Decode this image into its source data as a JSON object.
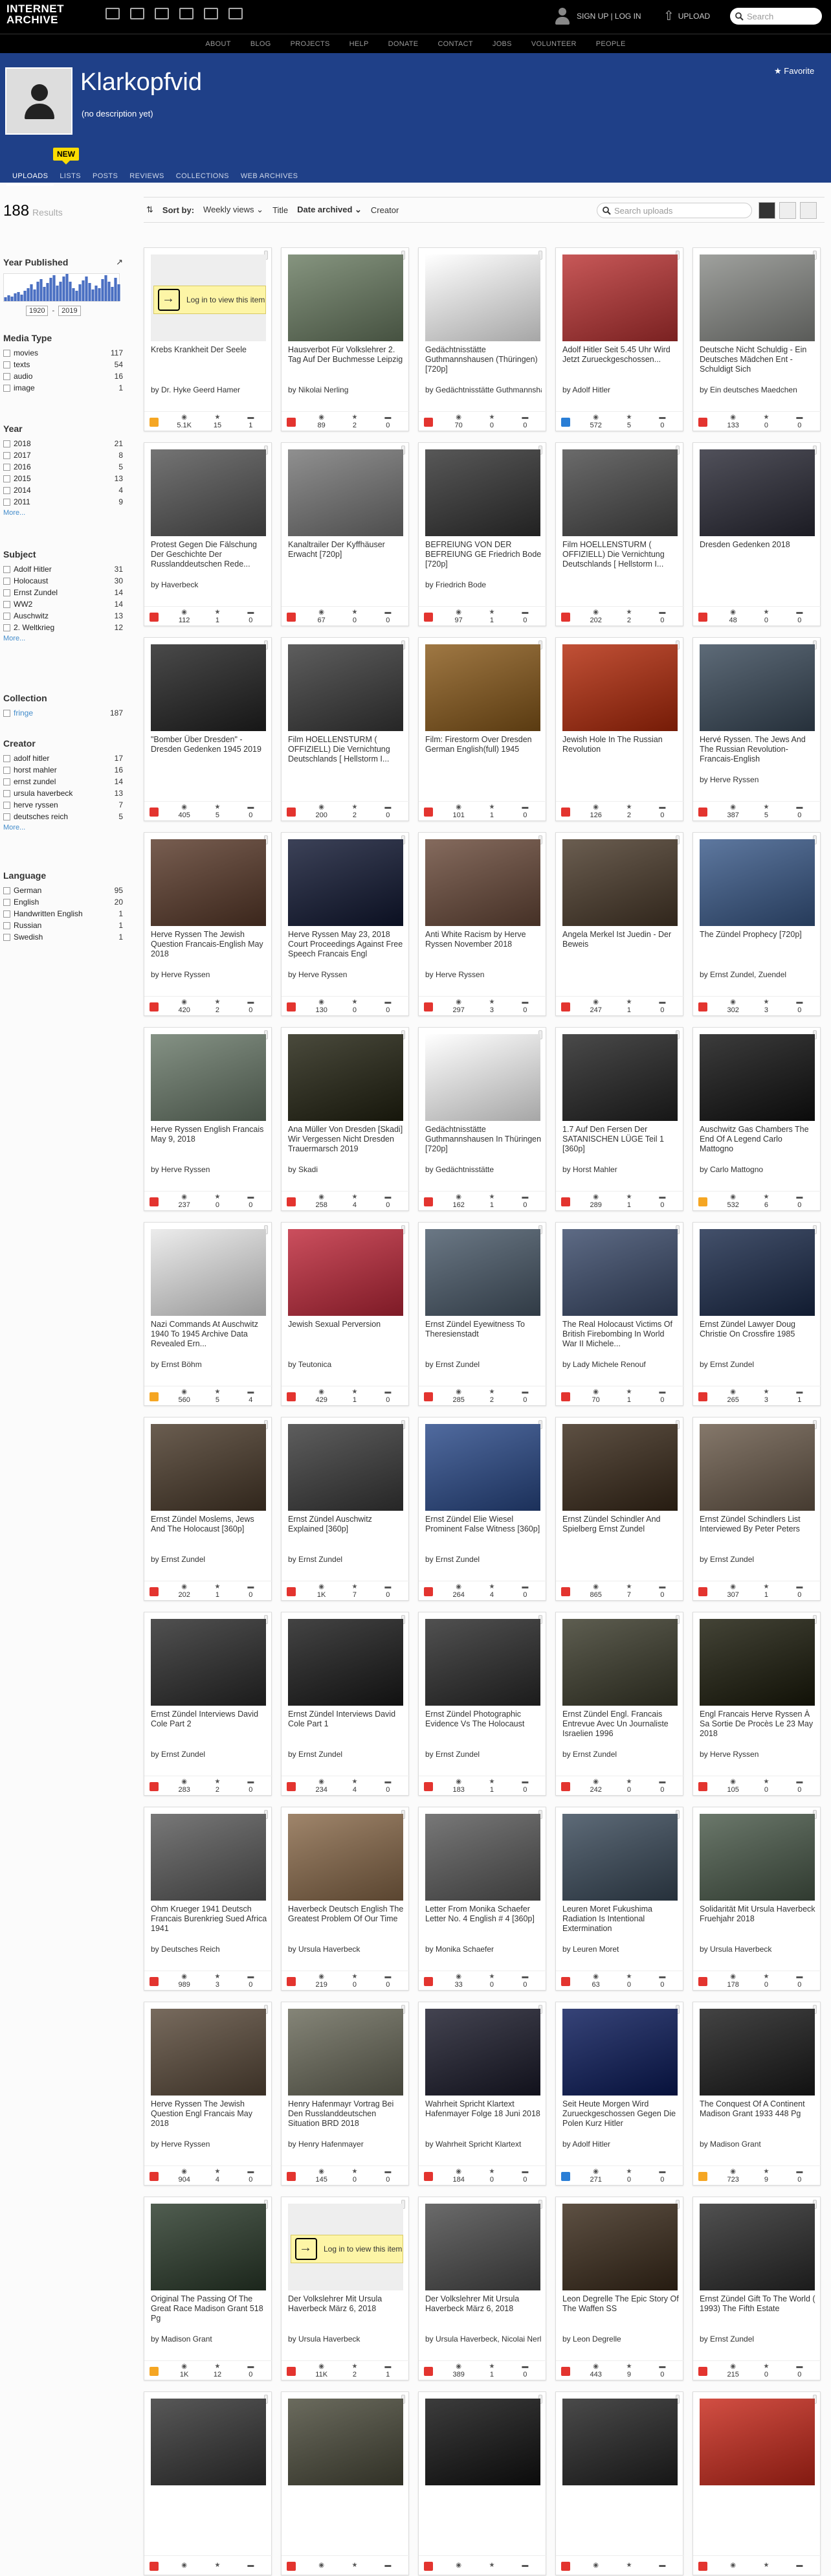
{
  "header": {
    "logo": "INTERNET\nARCHIVE",
    "signup": "SIGN UP | LOG IN",
    "upload": "UPLOAD",
    "search_placeholder": "Search",
    "nav": [
      "ABOUT",
      "BLOG",
      "PROJECTS",
      "HELP",
      "DONATE",
      "CONTACT",
      "JOBS",
      "VOLUNTEER",
      "PEOPLE"
    ]
  },
  "profile": {
    "title": "Klarkopfvid",
    "description": "(no description yet)",
    "favorite": "Favorite",
    "new_badge": "NEW",
    "tabs": [
      "UPLOADS",
      "LISTS",
      "POSTS",
      "REVIEWS",
      "COLLECTIONS",
      "WEB ARCHIVES"
    ]
  },
  "sidebar": {
    "results_count": "188",
    "results_label": "Results",
    "year_published": "Year Published",
    "year_from": "1920",
    "year_to": "2019",
    "more": "More...",
    "facets": [
      {
        "title": "Media Type",
        "items": [
          [
            "movies",
            "117"
          ],
          [
            "texts",
            "54"
          ],
          [
            "audio",
            "16"
          ],
          [
            "image",
            "1"
          ]
        ]
      },
      {
        "title": "Year",
        "items": [
          [
            "2018",
            "21"
          ],
          [
            "2017",
            "8"
          ],
          [
            "2016",
            "5"
          ],
          [
            "2015",
            "13"
          ],
          [
            "2014",
            "4"
          ],
          [
            "2011",
            "9"
          ]
        ],
        "more": true
      },
      {
        "title": "Subject",
        "items": [
          [
            "Adolf Hitler",
            "31"
          ],
          [
            "Holocaust",
            "30"
          ],
          [
            "Ernst Zundel",
            "14"
          ],
          [
            "WW2",
            "14"
          ],
          [
            "Auschwitz",
            "13"
          ],
          [
            "2. Weltkrieg",
            "12"
          ]
        ],
        "more": true
      },
      {
        "title": "Collection",
        "items": [
          [
            "fringe",
            "187"
          ]
        ]
      },
      {
        "title": "Creator",
        "items": [
          [
            "adolf hitler",
            "17"
          ],
          [
            "horst mahler",
            "16"
          ],
          [
            "ernst zundel",
            "14"
          ],
          [
            "ursula haverbeck",
            "13"
          ],
          [
            "herve ryssen",
            "7"
          ],
          [
            "deutsches reich",
            "5"
          ]
        ],
        "more": true
      },
      {
        "title": "Language",
        "items": [
          [
            "German",
            "95"
          ],
          [
            "English",
            "20"
          ],
          [
            "Handwritten English",
            "1"
          ],
          [
            "Russian",
            "1"
          ],
          [
            "Swedish",
            "1"
          ]
        ]
      }
    ]
  },
  "sortbar": {
    "label": "Sort by:",
    "options": [
      "Weekly views",
      "Title",
      "Date archived",
      "Creator"
    ],
    "search_placeholder": "Search uploads"
  },
  "items": [
    {
      "t": "Krebs Krankheit Der Seele",
      "by": "by Dr. Hyke Geerd Hamer",
      "views": "5.1K",
      "fav": "15",
      "rev": "1",
      "type": "text",
      "login": "Log in to view this item",
      "c": "#f3e8d4"
    },
    {
      "t": "Hausverbot Für Volkslehrer 2. Tag Auf Der Buchmesse Leipzig",
      "by": "by Nikolai Nerling",
      "views": "89",
      "fav": "2",
      "rev": "0",
      "type": "movie",
      "c": "#6b7d63"
    },
    {
      "t": "Gedächtnisstätte Guthmannshausen (Thüringen) [720p]",
      "by": "by Gedächtnisstätte Guthmannshausen",
      "views": "70",
      "fav": "0",
      "rev": "0",
      "type": "movie",
      "c": "#ffffff"
    },
    {
      "t": "Adolf Hitler Seit 5.45 Uhr Wird Jetzt Zurueckgeschossen...",
      "by": "by Adolf Hitler",
      "views": "572",
      "fav": "5",
      "rev": "0",
      "type": "audio",
      "c": "#b33"
    },
    {
      "t": "Deutsche Nicht Schuldig - Ein Deutsches Mädchen Ent - Schuldigt Sich",
      "by": "by Ein deutsches Maedchen",
      "views": "133",
      "fav": "0",
      "rev": "0",
      "type": "movie",
      "c": "#8a8c88"
    },
    {
      "t": "Protest Gegen Die Fälschung Der Geschichte Der Russlanddeutschen Rede...",
      "by": "by Haverbeck",
      "views": "112",
      "fav": "1",
      "rev": "0",
      "type": "movie",
      "c": "#555"
    },
    {
      "t": "Kanaltrailer Der Kyffhäuser Erwacht [720p]",
      "by": "",
      "views": "67",
      "fav": "0",
      "rev": "0",
      "type": "movie",
      "c": "#777"
    },
    {
      "t": "BEFREIUNG VON DER BEFREIUNG GE Friedrich Bode [720p]",
      "by": "by Friedrich Bode",
      "views": "97",
      "fav": "1",
      "rev": "0",
      "type": "movie",
      "c": "#333"
    },
    {
      "t": "Film HOELLENSTURM ( OFFIZIELL) Die Vernichtung Deutschlands [ Hellstorm I...",
      "by": "",
      "views": "202",
      "fav": "2",
      "rev": "0",
      "type": "movie",
      "c": "#4a4a4a"
    },
    {
      "t": "Dresden Gedenken 2018",
      "by": "",
      "views": "48",
      "fav": "0",
      "rev": "0",
      "type": "movie",
      "c": "#2a2a36"
    },
    {
      "t": "\"Bomber Über Dresden\" - Dresden Gedenken 1945 2019",
      "by": "",
      "views": "405",
      "fav": "5",
      "rev": "0",
      "type": "movie",
      "c": "#222"
    },
    {
      "t": "Film HOELLENSTURM ( OFFIZIELL) Die Vernichtung Deutschlands [ Hellstorm I...",
      "by": "",
      "views": "200",
      "fav": "2",
      "rev": "0",
      "type": "movie",
      "c": "#3a3a3a"
    },
    {
      "t": "Film: Firestorm Over Dresden German English(full) 1945",
      "by": "",
      "views": "101",
      "fav": "1",
      "rev": "0",
      "type": "movie",
      "c": "#8a5a1a"
    },
    {
      "t": "Jewish Hole In The Russian Revolution",
      "by": "",
      "views": "126",
      "fav": "2",
      "rev": "0",
      "type": "movie",
      "c": "#b42a0a"
    },
    {
      "t": "Hervé Ryssen. The Jews And The Russian Revolution-Francais-English",
      "by": "by Herve Ryssen",
      "views": "387",
      "fav": "5",
      "rev": "0",
      "type": "movie",
      "c": "#3a4a5a"
    },
    {
      "t": "Herve Ryssen The Jewish Question Francais-English May 2018",
      "by": "by Herve Ryssen",
      "views": "420",
      "fav": "2",
      "rev": "0",
      "type": "movie",
      "c": "#5a3a2a"
    },
    {
      "t": "Herve Ryssen May 23, 2018 Court Proceedings Against Free Speech Francais Engl",
      "by": "by Herve Ryssen",
      "views": "130",
      "fav": "0",
      "rev": "0",
      "type": "movie",
      "c": "#111833"
    },
    {
      "t": "Anti White Racism by Herve Ryssen November 2018",
      "by": "by Herve Ryssen",
      "views": "297",
      "fav": "3",
      "rev": "0",
      "type": "movie",
      "c": "#6a4a3a"
    },
    {
      "t": "Angela Merkel Ist Juedin - Der Beweis",
      "by": "",
      "views": "247",
      "fav": "1",
      "rev": "0",
      "type": "movie",
      "c": "#4a3a2a"
    },
    {
      "t": "The Zündel Prophecy [720p]",
      "by": "by Ernst Zundel, Zuendel",
      "views": "302",
      "fav": "3",
      "rev": "0",
      "type": "movie",
      "c": "#3a5a8a"
    },
    {
      "t": "Herve Ryssen English Francais May 9, 2018",
      "by": "by Herve Ryssen",
      "views": "237",
      "fav": "0",
      "rev": "0",
      "type": "movie",
      "c": "#6a7a6a"
    },
    {
      "t": "Ana Müller Von Dresden [Skadi] Wir Vergessen Nicht Dresden Trauermarsch 2019",
      "by": "by Skadi",
      "views": "258",
      "fav": "4",
      "rev": "0",
      "type": "movie",
      "c": "#222211"
    },
    {
      "t": "Gedächtnisstätte Guthmannshausen In Thüringen [720p]",
      "by": "by Gedächtnisstätte",
      "views": "162",
      "fav": "1",
      "rev": "0",
      "type": "movie",
      "c": "#ffffff"
    },
    {
      "t": "1.7 Auf Den Fersen Der SATANISCHEN LÜGE Teil 1 [360p]",
      "by": "by Horst Mahler",
      "views": "289",
      "fav": "1",
      "rev": "0",
      "type": "movie",
      "c": "#222"
    },
    {
      "t": "Auschwitz Gas Chambers The End Of A Legend Carlo Mattogno",
      "by": "by Carlo Mattogno",
      "views": "532",
      "fav": "6",
      "rev": "0",
      "type": "text",
      "c": "#111"
    },
    {
      "t": "Nazi Commands At Auschwitz 1940 To 1945 Archive Data Revealed Ern...",
      "by": "by Ernst Böhm",
      "views": "560",
      "fav": "5",
      "rev": "4",
      "type": "text",
      "c": "#e8e8e8"
    },
    {
      "t": "Jewish Sexual Perversion",
      "by": "by Teutonica",
      "views": "429",
      "fav": "1",
      "rev": "0",
      "type": "movie",
      "c": "#c0283a"
    },
    {
      "t": "Ernst Zündel Eyewitness To Theresienstadt",
      "by": "by Ernst Zundel",
      "views": "285",
      "fav": "2",
      "rev": "0",
      "type": "movie",
      "c": "#4a5a6a"
    },
    {
      "t": "The Real Holocaust Victims Of British Firebombing In World War II Michele...",
      "by": "by Lady Michele Renouf",
      "views": "70",
      "fav": "1",
      "rev": "0",
      "type": "movie",
      "c": "#3a4a6a"
    },
    {
      "t": "Ernst Zündel Lawyer Doug Christie On Crossfire 1985",
      "by": "by Ernst Zundel",
      "views": "265",
      "fav": "3",
      "rev": "1",
      "type": "movie",
      "c": "#1a2a4a"
    },
    {
      "t": "Ernst Zündel Moslems, Jews And The Holocaust [360p]",
      "by": "by Ernst Zundel",
      "views": "202",
      "fav": "1",
      "rev": "0",
      "type": "movie",
      "c": "#4a3a2a"
    },
    {
      "t": "Ernst Zündel Auschwitz Explained [360p]",
      "by": "by Ernst Zundel",
      "views": "1K",
      "fav": "7",
      "rev": "0",
      "type": "movie",
      "c": "#3a3a3a"
    },
    {
      "t": "Ernst Zündel Elie Wiesel Prominent False Witness [360p]",
      "by": "by Ernst Zundel",
      "views": "264",
      "fav": "4",
      "rev": "0",
      "type": "movie",
      "c": "#2a4a8a"
    },
    {
      "t": "Ernst Zündel Schindler And Spielberg Ernst Zundel",
      "by": "",
      "views": "865",
      "fav": "7",
      "rev": "0",
      "type": "movie",
      "c": "#3a2a1a"
    },
    {
      "t": "Ernst Zündel Schindlers List Interviewed By Peter Peters",
      "by": "by Ernst Zundel",
      "views": "307",
      "fav": "1",
      "rev": "0",
      "type": "movie",
      "c": "#6a5a4a"
    },
    {
      "t": "Ernst Zündel Interviews David Cole Part 2",
      "by": "by Ernst Zundel",
      "views": "283",
      "fav": "2",
      "rev": "0",
      "type": "movie",
      "c": "#2a2a2a"
    },
    {
      "t": "Ernst Zündel Interviews David Cole Part 1",
      "by": "by Ernst Zundel",
      "views": "234",
      "fav": "4",
      "rev": "0",
      "type": "movie",
      "c": "#1a1a1a"
    },
    {
      "t": "Ernst Zündel Photographic Evidence Vs The Holocaust",
      "by": "by Ernst Zundel",
      "views": "183",
      "fav": "1",
      "rev": "0",
      "type": "movie",
      "c": "#2a2a2a"
    },
    {
      "t": "Ernst Zündel Engl. Francais Entrevue Avec Un Journaliste Israelien 1996",
      "by": "by Ernst Zundel",
      "views": "242",
      "fav": "0",
      "rev": "0",
      "type": "movie",
      "c": "#3a3a2a"
    },
    {
      "t": "Engl Francais Herve Ryssen À Sa Sortie De Procès Le 23 May 2018",
      "by": "by Herve Ryssen",
      "views": "105",
      "fav": "0",
      "rev": "0",
      "type": "movie",
      "c": "#1a1a0a"
    },
    {
      "t": "Ohm Krueger 1941 Deutsch Francais Burenkrieg Sued Africa 1941",
      "by": "by Deutsches Reich",
      "views": "989",
      "fav": "3",
      "rev": "0",
      "type": "movie",
      "c": "#5a5a5a"
    },
    {
      "t": "Haverbeck Deutsch English The Greatest Problem Of Our Time",
      "by": "by Ursula Haverbeck",
      "views": "219",
      "fav": "0",
      "rev": "0",
      "type": "movie",
      "c": "#8a6a4a"
    },
    {
      "t": "Letter From Monika Schaefer Letter No. 4 English # 4 [360p]",
      "by": "by Monika Schaefer",
      "views": "33",
      "fav": "0",
      "rev": "0",
      "type": "movie",
      "c": "#5a5a5a"
    },
    {
      "t": "Leuren Moret Fukushima Radiation Is Intentional Extermination",
      "by": "by Leuren Moret",
      "views": "63",
      "fav": "0",
      "rev": "0",
      "type": "movie",
      "c": "#3a4a5a"
    },
    {
      "t": "Solidarität Mit Ursula Haverbeck Fruehjahr 2018",
      "by": "by Ursula Haverbeck",
      "views": "178",
      "fav": "0",
      "rev": "0",
      "type": "movie",
      "c": "#4a5a4a"
    },
    {
      "t": "Herve Ryssen The Jewish Question Engl Francais May 2018",
      "by": "by Herve Ryssen",
      "views": "904",
      "fav": "4",
      "rev": "0",
      "type": "movie",
      "c": "#5a4a3a"
    },
    {
      "t": "Henry Hafenmayr Vortrag Bei Den Russlanddeutschen Situation BRD 2018",
      "by": "by Henry Hafenmayer",
      "views": "145",
      "fav": "0",
      "rev": "0",
      "type": "movie",
      "c": "#6a6a5a"
    },
    {
      "t": "Wahrheit Spricht Klartext Hafenmayer Folge 18 Juni 2018",
      "by": "by Wahrheit Spricht Klartext",
      "views": "184",
      "fav": "0",
      "rev": "0",
      "type": "movie",
      "c": "#1a1a2a"
    },
    {
      "t": "Seit Heute Morgen Wird Zurueckgeschossen Gegen Die Polen Kurz Hitler",
      "by": "by Adolf Hitler",
      "views": "271",
      "fav": "0",
      "rev": "0",
      "type": "audio",
      "c": "#0a1a5a"
    },
    {
      "t": "The Conquest Of A Continent Madison Grant 1933 448 Pg",
      "by": "by Madison Grant",
      "views": "723",
      "fav": "9",
      "rev": "0",
      "type": "text",
      "c": "#1a1a1a"
    },
    {
      "t": "Original The Passing Of The Great Race Madison Grant 518 Pg",
      "by": "by Madison Grant",
      "views": "1K",
      "fav": "12",
      "rev": "0",
      "type": "text",
      "c": "#2a3a2a"
    },
    {
      "t": "Der Volkslehrer Mit Ursula Haverbeck März 6, 2018",
      "by": "by Ursula Haverbeck",
      "views": "11K",
      "fav": "2",
      "rev": "1",
      "type": "movie",
      "login": "Log in to view this item",
      "c": "#3a3a3a"
    },
    {
      "t": "Der Volkslehrer Mit Ursula Haverbeck März 6, 2018",
      "by": "by Ursula Haverbeck, Nicolai Nerling",
      "views": "389",
      "fav": "1",
      "rev": "0",
      "type": "movie",
      "c": "#4a4a4a"
    },
    {
      "t": "Leon Degrelle The Epic Story Of The Waffen SS",
      "by": "by Leon Degrelle",
      "views": "443",
      "fav": "9",
      "rev": "0",
      "type": "movie",
      "c": "#3a2a1a"
    },
    {
      "t": "Ernst Zündel Gift To The World ( 1993) The Fifth Estate",
      "by": "by Ernst Zundel",
      "views": "215",
      "fav": "0",
      "rev": "0",
      "type": "movie",
      "c": "#2a2a2a"
    },
    {
      "t": "",
      "by": "",
      "views": "",
      "fav": "",
      "rev": "",
      "type": "movie",
      "c": "#333"
    },
    {
      "t": "",
      "by": "",
      "views": "",
      "fav": "",
      "rev": "",
      "type": "movie",
      "c": "#4a4a3a"
    },
    {
      "t": "",
      "by": "",
      "views": "",
      "fav": "",
      "rev": "",
      "type": "movie",
      "c": "#111"
    },
    {
      "t": "",
      "by": "",
      "views": "",
      "fav": "",
      "rev": "",
      "type": "movie",
      "c": "#222"
    },
    {
      "t": "",
      "by": "",
      "views": "",
      "fav": "",
      "rev": "",
      "type": "movie",
      "c": "#c8281a"
    }
  ]
}
